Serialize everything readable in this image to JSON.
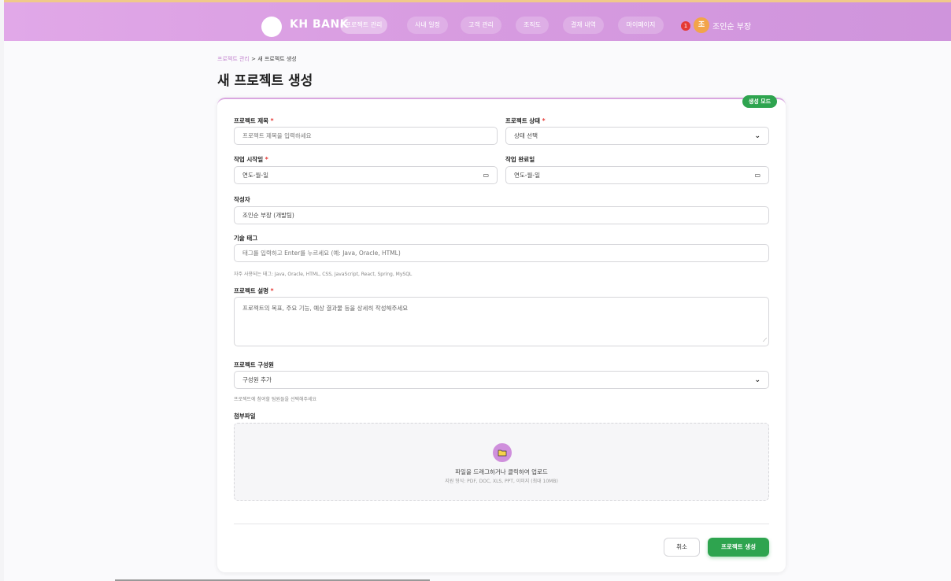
{
  "header": {
    "brand": "KH BANK",
    "nav": [
      {
        "label": "프로젝트 관리",
        "active": true
      },
      {
        "label": "사내 일정",
        "active": false
      },
      {
        "label": "고객 관리",
        "active": false
      },
      {
        "label": "조직도",
        "active": false
      },
      {
        "label": "결재 내역",
        "active": false
      },
      {
        "label": "마이페이지",
        "active": false
      }
    ],
    "notification_count": "1",
    "avatar_initial": "조",
    "user_name": "조인순 부장"
  },
  "breadcrumb": {
    "parent": "프로젝트 관리",
    "separator": " > ",
    "current": "새 프로젝트 생성"
  },
  "page_title": "새 프로젝트 생성",
  "mode_badge": "생성 모드",
  "form": {
    "title": {
      "label": "프로젝트 제목",
      "required": "*",
      "placeholder": "프로젝트 제목을 입력하세요"
    },
    "status": {
      "label": "프로젝트 상태",
      "required": "*",
      "value": "상태 선택"
    },
    "start_date": {
      "label": "작업 시작일",
      "required": "*",
      "value": "연도-월-일"
    },
    "end_date": {
      "label": "작업 완료일",
      "value": "연도-월-일"
    },
    "author": {
      "label": "작성자",
      "value": "조인순 부장 (개발팀)"
    },
    "tags": {
      "label": "기술 태그",
      "placeholder": "태그를 입력하고 Enter를 누르세요 (예: Java, Oracle, HTML)",
      "hint": "자주 사용되는 태그: Java, Oracle, HTML, CSS, JavaScript, React, Spring, MySQL"
    },
    "description": {
      "label": "프로젝트 설명",
      "required": "*",
      "placeholder": "프로젝트의 목표, 주요 기능, 예상 결과물 등을 상세히 작성해주세요"
    },
    "members": {
      "label": "프로젝트 구성원",
      "value": "구성원 추가",
      "hint": "프로젝트에 참여할 팀원들을 선택해주세요"
    },
    "attachment": {
      "label": "첨부파일",
      "drop_title": "파일을 드래그하거나 클릭하여 업로드",
      "drop_sub": "지원 형식: PDF, DOC, XLS, PPT, 이미지 (최대 10MB)"
    }
  },
  "actions": {
    "cancel": "취소",
    "create": "프로젝트 생성"
  },
  "colors": {
    "accent": "#d79be0",
    "primary_button": "#2ea44f",
    "required": "#e53935"
  }
}
